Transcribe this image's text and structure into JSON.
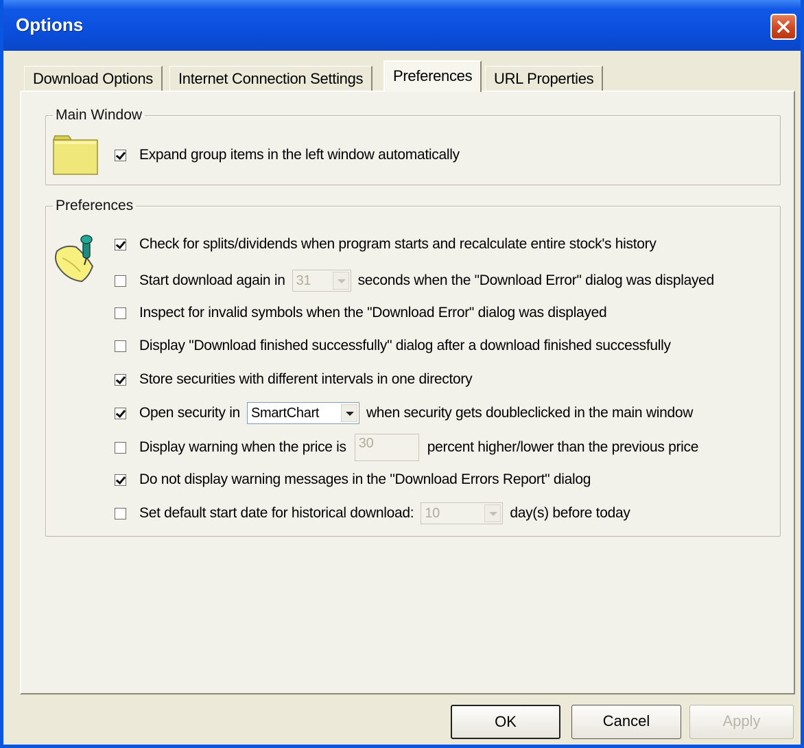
{
  "window": {
    "title": "Options"
  },
  "tabs": [
    {
      "label": "Download Options"
    },
    {
      "label": "Internet Connection Settings"
    },
    {
      "label": "Preferences"
    },
    {
      "label": "URL Properties"
    }
  ],
  "active_tab": "Preferences",
  "main_window_group": {
    "legend": "Main Window",
    "icon": "folder-icon",
    "expand_items": {
      "label": "Expand group items in the left window automatically",
      "checked": true
    }
  },
  "preferences_group": {
    "legend": "Preferences",
    "icon": "sticky-note-icon",
    "check_splits": {
      "label": "Check for splits/dividends when program starts and recalculate entire stock's history",
      "checked": true
    },
    "start_download_again": {
      "prefix": "Start download again in",
      "value": "31",
      "suffix": "seconds when the \"Download Error\" dialog was displayed",
      "checked": false,
      "enabled": false
    },
    "inspect_symbols": {
      "label": "Inspect for invalid symbols when the \"Download Error\" dialog was displayed",
      "checked": false
    },
    "display_finished": {
      "label": "Display \"Download finished successfully\" dialog after a download finished successfully",
      "checked": false
    },
    "store_securities": {
      "label": "Store securities with different intervals in one directory",
      "checked": true
    },
    "open_security": {
      "prefix": "Open security in",
      "value": "SmartChart",
      "suffix": "when security gets doubleclicked in the main window",
      "checked": true
    },
    "display_warning": {
      "prefix": "Display warning when the price is",
      "value": "30",
      "suffix": "percent higher/lower than the previous price",
      "checked": false,
      "enabled": false
    },
    "no_warning_msgs": {
      "label": "Do not display warning messages in the \"Download Errors Report\" dialog",
      "checked": true
    },
    "default_start_date": {
      "prefix": "Set default start date for historical download:",
      "value": "10",
      "suffix": "day(s) before today",
      "checked": false,
      "enabled": false
    }
  },
  "buttons": {
    "ok": "OK",
    "cancel": "Cancel",
    "apply": "Apply"
  },
  "colors": {
    "title_bar": "#0a4fdd",
    "face": "#ece9d8",
    "close": "#cf4622"
  }
}
